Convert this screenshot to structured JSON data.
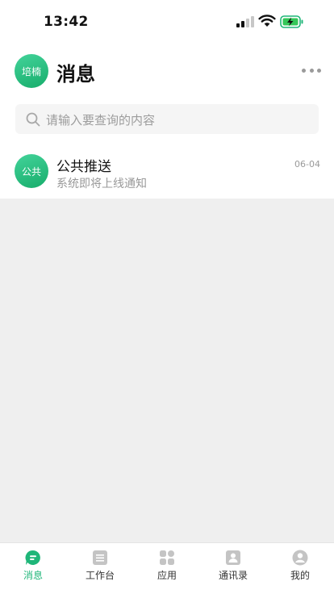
{
  "status_bar": {
    "time": "13:42"
  },
  "header": {
    "avatar_text": "培楠",
    "title": "消息"
  },
  "search": {
    "placeholder": "请输入要查询的内容"
  },
  "messages": [
    {
      "avatar_text": "公共",
      "name": "公共推送",
      "preview": "系统即将上线通知",
      "time": "06-04"
    }
  ],
  "tabs": [
    {
      "label": "消息",
      "icon": "message-icon",
      "active": true
    },
    {
      "label": "工作台",
      "icon": "workbench-icon",
      "active": false
    },
    {
      "label": "应用",
      "icon": "apps-grid-icon",
      "active": false
    },
    {
      "label": "通讯录",
      "icon": "contacts-icon",
      "active": false
    },
    {
      "label": "我的",
      "icon": "profile-icon",
      "active": false
    }
  ],
  "colors": {
    "accent": "#1fb679",
    "background": "#efefef",
    "icon_gray": "#c4c4c4"
  }
}
